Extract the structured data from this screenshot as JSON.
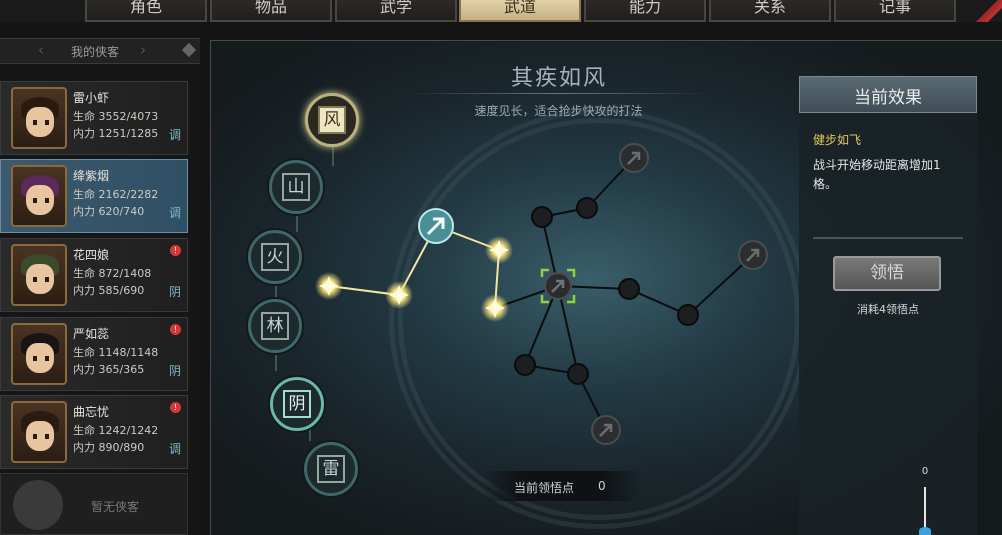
{
  "tabs": [
    {
      "label": "角色",
      "active": false
    },
    {
      "label": "物品",
      "active": false
    },
    {
      "label": "武学",
      "active": false
    },
    {
      "label": "武道",
      "active": true
    },
    {
      "label": "能力",
      "active": false
    },
    {
      "label": "关系",
      "active": false
    },
    {
      "label": "记事",
      "active": false
    }
  ],
  "sidebar": {
    "title": "我的侠客",
    "heroes": [
      {
        "name": "雷小虾",
        "hp": "生命 3552/4073",
        "mp": "内力 1251/1285",
        "tag": "调",
        "alert": false
      },
      {
        "name": "绛紫烟",
        "hp": "生命 2162/2282",
        "mp": "内力 620/740",
        "tag": "调",
        "alert": false
      },
      {
        "name": "花四娘",
        "hp": "生命 872/1408",
        "mp": "内力 585/690",
        "tag": "阴",
        "alert": true
      },
      {
        "name": "严如蕊",
        "hp": "生命 1148/1148",
        "mp": "内力 365/365",
        "tag": "阴",
        "alert": true
      },
      {
        "name": "曲忘忧",
        "hp": "生命 1242/1242",
        "mp": "内力 890/890",
        "tag": "调",
        "alert": true
      }
    ],
    "empty_slot": "暂无侠客"
  },
  "skill": {
    "title": "其疾如风",
    "description": "速度见长，适合抢步快攻的打法",
    "elements": [
      {
        "char": "风",
        "state": "active"
      },
      {
        "char": "山",
        "state": "dim"
      },
      {
        "char": "火",
        "state": "dim"
      },
      {
        "char": "林",
        "state": "dim"
      },
      {
        "char": "阴",
        "state": "lit"
      },
      {
        "char": "雷",
        "state": "dim"
      }
    ]
  },
  "effect": {
    "header": "当前效果",
    "name": "健步如飞",
    "text": "战斗开始移动距离增加1格。",
    "button": "领悟",
    "cost": "消耗4领悟点"
  },
  "points": {
    "label": "当前领悟点",
    "value": "0"
  },
  "zoom": {
    "label": "0"
  },
  "icons": {
    "node_arrow": "arrow-up-right-icon",
    "star": "sparkle-star-icon",
    "cursor": "pointer-cursor-icon"
  },
  "colors": {
    "active_tab": "#d6c39a",
    "selected_hero": "#3d5a6e",
    "glow": "#fff3a0",
    "effect_name": "#e0c860"
  }
}
